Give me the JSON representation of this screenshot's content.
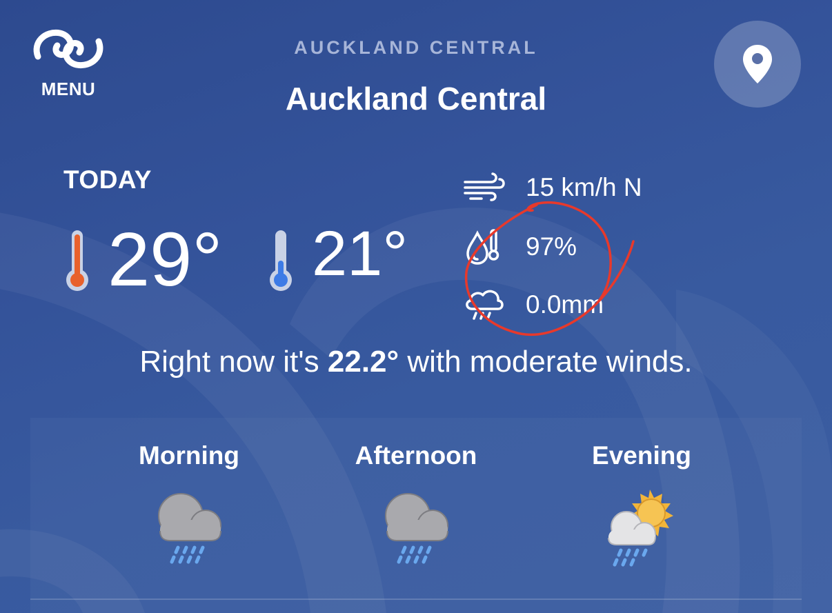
{
  "header": {
    "menu_label": "MENU",
    "location_subtitle": "AUCKLAND CENTRAL",
    "location_title": "Auckland Central",
    "menu_icon": "swirl-logo-icon",
    "location_icon": "map-pin-icon"
  },
  "today": {
    "label": "TODAY",
    "high": "29°",
    "low": "21°",
    "wind": "15 km/h N",
    "humidity": "97%",
    "rainfall": "0.0mm"
  },
  "now": {
    "prefix": "Right now it's ",
    "temp": "22.2°",
    "suffix": " with moderate winds."
  },
  "periods": [
    {
      "label": "Morning",
      "icon": "rain-cloud-icon"
    },
    {
      "label": "Afternoon",
      "icon": "rain-cloud-icon"
    },
    {
      "label": "Evening",
      "icon": "sun-cloud-rain-icon"
    }
  ],
  "colors": {
    "background": "#2f4c8c",
    "high_temp": "#e8612c",
    "low_temp": "#3d7be6",
    "annotation": "#e8392b",
    "rain_drops": "#6aa8ee",
    "sun": "#f2b53a"
  }
}
